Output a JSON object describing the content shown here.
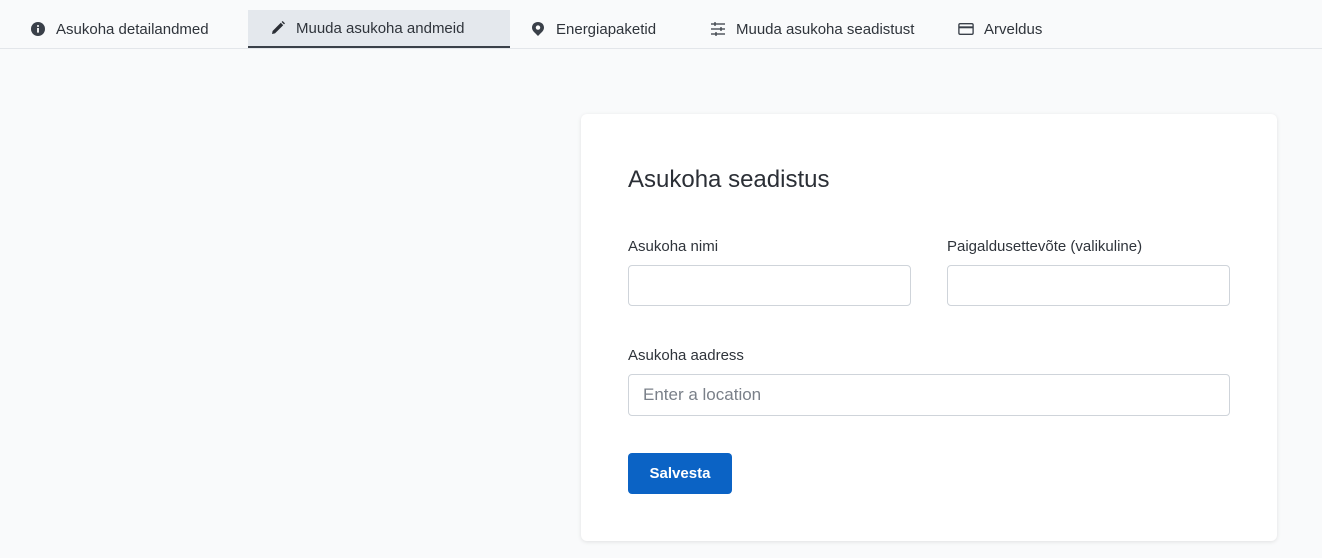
{
  "tabs": [
    {
      "label": "Asukoha detailandmed",
      "icon": "info-circle-icon",
      "active": false
    },
    {
      "label": "Muuda asukoha andmeid",
      "icon": "pencil-icon",
      "active": true
    },
    {
      "label": "Energiapaketid",
      "icon": "location-pin-icon",
      "active": false
    },
    {
      "label": "Muuda asukoha seadistust",
      "icon": "sliders-icon",
      "active": false
    },
    {
      "label": "Arveldus",
      "icon": "credit-card-icon",
      "active": false
    }
  ],
  "form": {
    "title": "Asukoha seadistus",
    "name_label": "Asukoha nimi",
    "name_value": "",
    "installer_label": "Paigaldusettevõte (valikuline)",
    "installer_value": "",
    "address_label": "Asukoha aadress",
    "address_placeholder": "Enter a location",
    "save_label": "Salvesta"
  },
  "colors": {
    "accent": "#0b63c5",
    "active_tab_bg": "#e4e8ed",
    "page_bg": "#f9fafb"
  }
}
